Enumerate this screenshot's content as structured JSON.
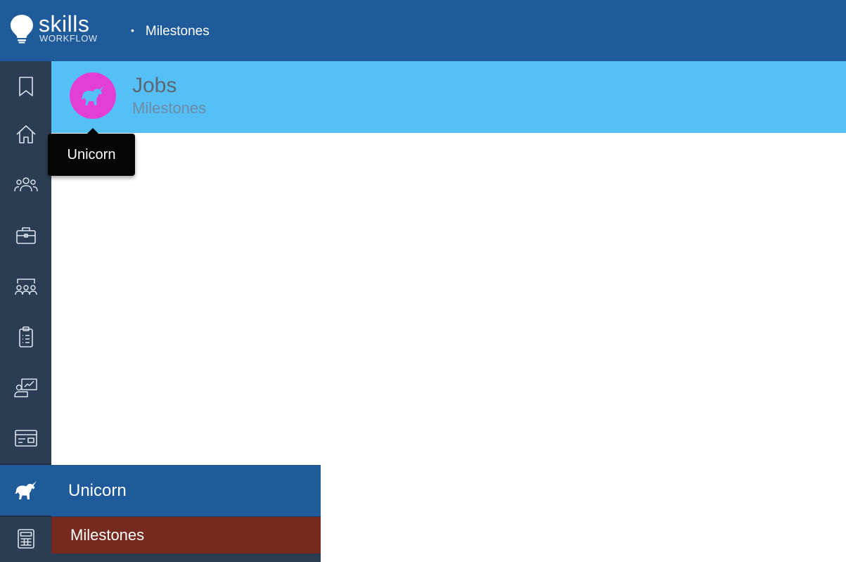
{
  "brand": {
    "name": "skills",
    "tagline": "WORKFLOW"
  },
  "breadcrumb": {
    "current": "Milestones"
  },
  "header": {
    "avatar_icon": "unicorn-icon",
    "avatar_color": "#e33fd4",
    "title": "Jobs",
    "subtitle": "Milestones"
  },
  "tooltip": {
    "text": "Unicorn"
  },
  "rail": {
    "items": [
      {
        "icon": "bookmark-icon"
      },
      {
        "icon": "home-icon"
      },
      {
        "icon": "people-icon"
      },
      {
        "icon": "briefcase-icon"
      },
      {
        "icon": "team-meeting-icon"
      },
      {
        "icon": "clipboard-list-icon"
      },
      {
        "icon": "presentation-chart-icon"
      },
      {
        "icon": "id-card-icon"
      },
      {
        "icon": "unicorn-icon",
        "active": true
      },
      {
        "icon": "calculator-icon"
      }
    ]
  },
  "flyout": {
    "title": "Unicorn",
    "items": [
      {
        "label": "Milestones",
        "selected": true
      }
    ]
  },
  "colors": {
    "topbar": "#1f5b9b",
    "rail": "#2b3d52",
    "header_band": "#55c0f5",
    "selected_item": "#76291e"
  }
}
